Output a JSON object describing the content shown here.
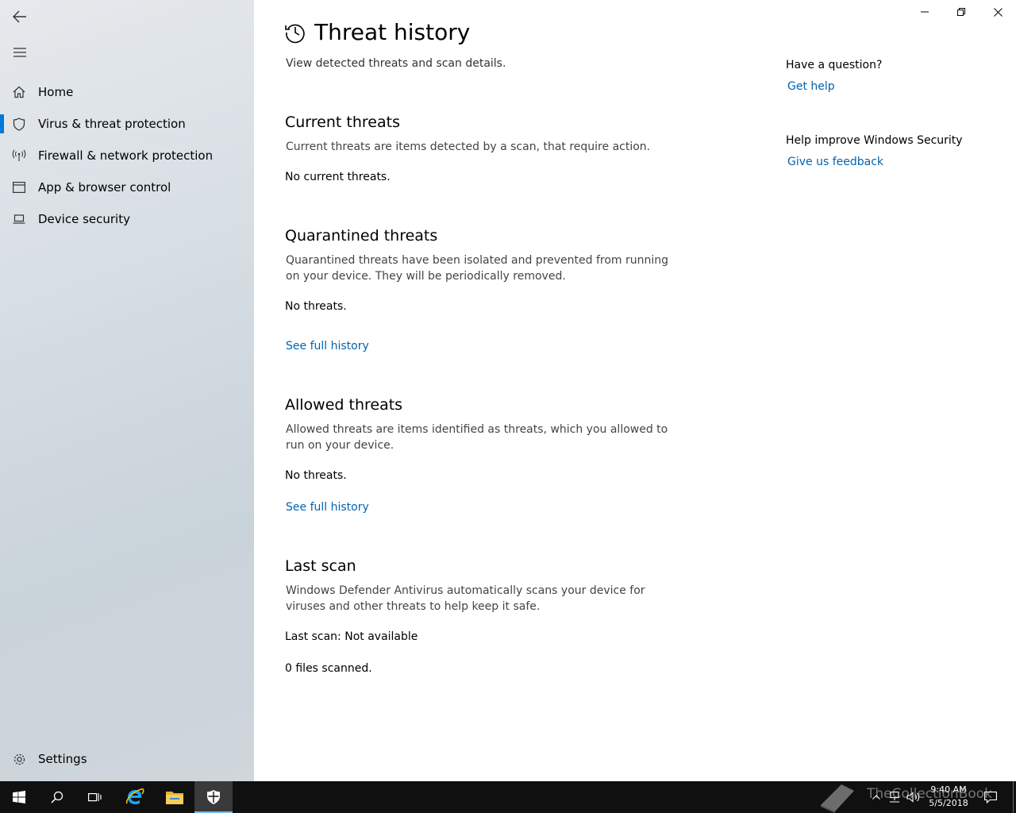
{
  "sidebar": {
    "back_icon": "back-arrow-icon",
    "menu_icon": "hamburger-menu-icon",
    "items": [
      {
        "label": "Home",
        "icon": "home-icon",
        "active": false
      },
      {
        "label": "Virus & threat protection",
        "icon": "shield-icon",
        "active": true
      },
      {
        "label": "Firewall & network protection",
        "icon": "antenna-icon",
        "active": false
      },
      {
        "label": "App & browser control",
        "icon": "browser-window-icon",
        "active": false
      },
      {
        "label": "Device security",
        "icon": "laptop-icon",
        "active": false
      }
    ],
    "settings_label": "Settings"
  },
  "page": {
    "title": "Threat history",
    "subtitle": "View detected threats and scan details."
  },
  "sections": {
    "current": {
      "heading": "Current threats",
      "description": "Current threats are items detected by a scan, that require action.",
      "value": "No current threats."
    },
    "quarantined": {
      "heading": "Quarantined threats",
      "description": "Quarantined threats have been isolated and prevented from running on your device.  They will be periodically removed.",
      "value": "No threats.",
      "link": "See full history"
    },
    "allowed": {
      "heading": "Allowed threats",
      "description": "Allowed threats are items identified as threats, which you allowed to run on your device.",
      "value": "No threats.",
      "link": "See full history"
    },
    "last_scan": {
      "heading": "Last scan",
      "description": "Windows Defender Antivirus automatically scans your device for viruses and other threats to help keep it safe.",
      "value": "Last scan:  Not available",
      "files": "0 files scanned."
    }
  },
  "help": {
    "question": "Have a question?",
    "get_help": "Get help",
    "improve": "Help improve Windows Security",
    "feedback": "Give us feedback"
  },
  "taskbar": {
    "time": "9:40 AM",
    "date": "5/5/2018",
    "watermark": "TheCollectionBook"
  },
  "colors": {
    "accent": "#0078d7",
    "link": "#0063b1",
    "taskbar": "#101010"
  }
}
